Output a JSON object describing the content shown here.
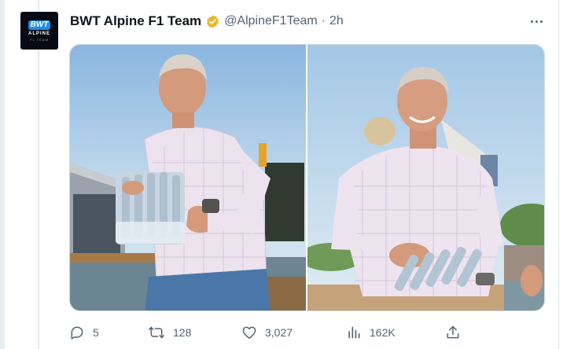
{
  "tweet": {
    "author": {
      "display_name": "BWT Alpine F1 Team",
      "handle": "@AlpineF1Team",
      "separator": "·",
      "time": "2h",
      "avatar_text": {
        "top": "BWT",
        "middle": "ALPINE",
        "bottom": "F1 TEAM"
      }
    },
    "media": [
      {
        "icon": "photo-jeremy-carrying-water-bottles"
      },
      {
        "icon": "photo-jeremy-smiling-with-water-bottles"
      }
    ],
    "actions": {
      "replies": "5",
      "retweets": "128",
      "likes": "3,027",
      "views": "162K"
    }
  },
  "colors": {
    "text_primary": "#0f1419",
    "text_secondary": "#536471",
    "verified_gold": "#e8b829",
    "border": "#cfd9de"
  }
}
